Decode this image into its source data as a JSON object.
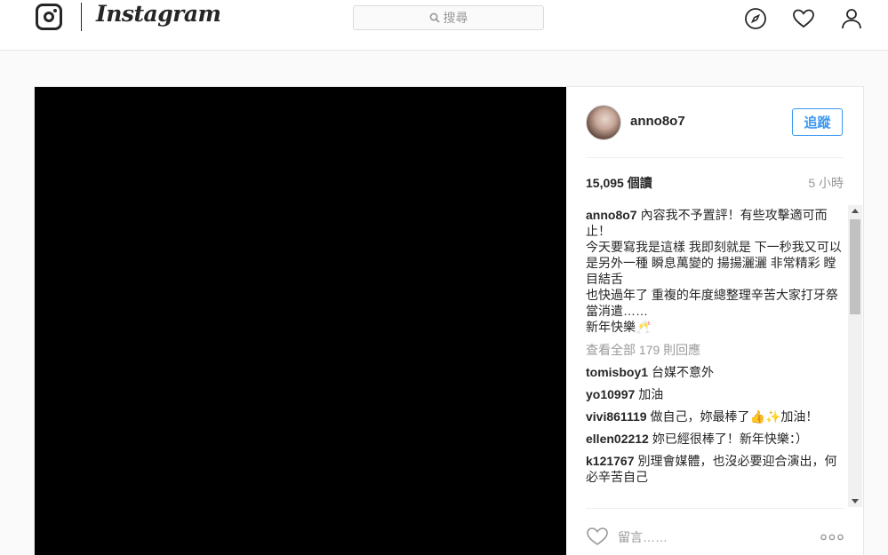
{
  "app": {
    "name": "Instagram",
    "icons": {
      "logo": "instagram-camera-icon",
      "search": "search-icon",
      "explore": "compass-icon",
      "activity": "heart-icon",
      "profile": "person-icon",
      "like": "heart-outline-icon",
      "more": "more-options-icon"
    }
  },
  "search": {
    "placeholder": "搜尋"
  },
  "post": {
    "username": "anno8o7",
    "follow_label": "追蹤",
    "views": "15,095 個讀",
    "time": "5 小時",
    "caption_user": "anno8o7",
    "caption_lines": [
      "內容我不予置評！有些攻擊適可而止！",
      "今天要寫我是這樣 我即刻就是 下一秒我又可以是另外一種 瞬息萬變的 揚揚灑灑 非常精彩 瞠目結舌",
      "也快過年了 重複的年度總整理辛苦大家打牙祭當消遣……",
      "新年快樂🥂"
    ],
    "view_all": "查看全部 179 則回應",
    "comments": [
      {
        "user": "tomisboy1",
        "text": "台媒不意外"
      },
      {
        "user": "yo10997",
        "text": "加油"
      },
      {
        "user": "vivi861119",
        "text": "做自己，妳最棒了👍✨加油！"
      },
      {
        "user": "ellen02212",
        "text": "妳已經很棒了！新年快樂：）"
      },
      {
        "user": "k121767",
        "text": "別理會媒體，也沒必要迎合演出，何必辛苦自己"
      }
    ],
    "comment_placeholder": "留言……"
  },
  "colors": {
    "accent": "#3897f0",
    "text": "#262626",
    "muted": "#999999",
    "border": "#e6e6e6",
    "background": "#fafafa"
  }
}
